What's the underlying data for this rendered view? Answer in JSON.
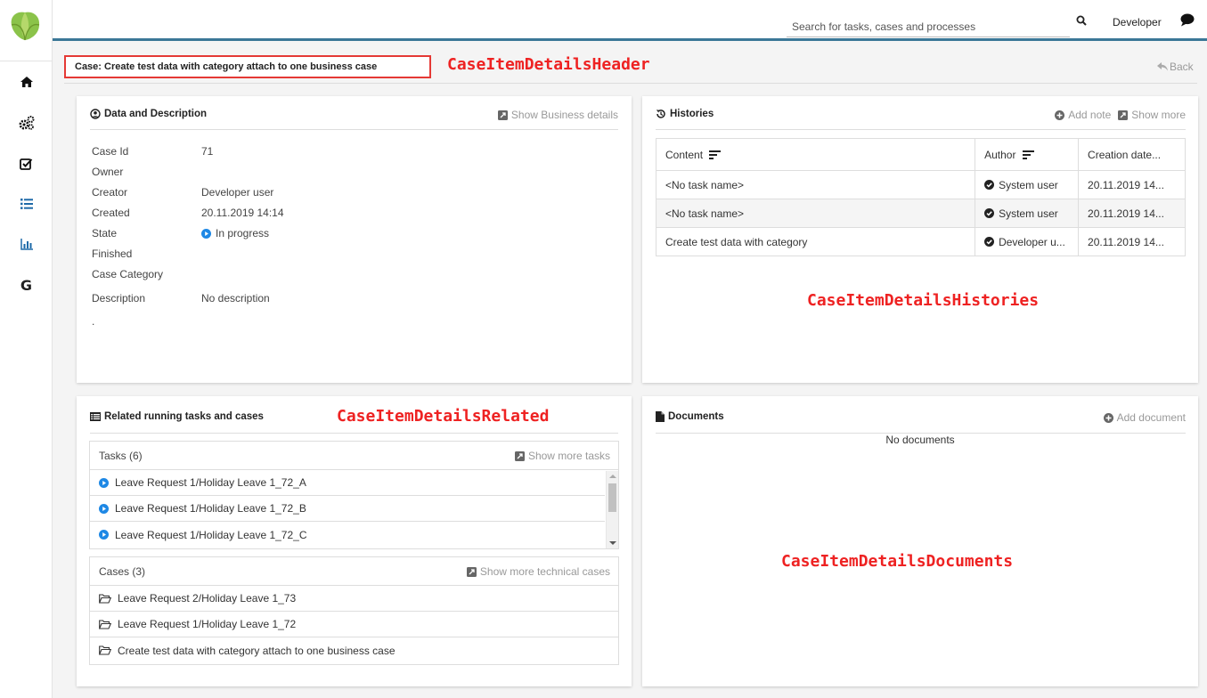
{
  "topbar": {
    "search_placeholder": "Search for tasks, cases and processes",
    "user_name": "Developer"
  },
  "sidebar": {
    "items": [
      {
        "icon": "home-icon"
      },
      {
        "icon": "processes-icon"
      },
      {
        "icon": "tasks-icon"
      },
      {
        "icon": "cases-list-icon"
      },
      {
        "icon": "statistics-icon"
      },
      {
        "icon": "google-icon",
        "label": "G"
      }
    ]
  },
  "header": {
    "case_title": "Case: Create test data with category attach to one business case",
    "back_label": "Back"
  },
  "annotations": {
    "header": "CaseItemDetailsHeader",
    "histories": "CaseItemDetailsHistories",
    "related": "CaseItemDetailsRelated",
    "documents": "CaseItemDetailsDocuments"
  },
  "data_description": {
    "title": "Data and Description",
    "action": "Show Business details",
    "rows": [
      {
        "label": "Case Id",
        "value": "71"
      },
      {
        "label": "Owner",
        "value": ""
      },
      {
        "label": "Creator",
        "value": "Developer user"
      },
      {
        "label": "Created",
        "value": "20.11.2019 14:14"
      },
      {
        "label": "State",
        "value": "In progress"
      },
      {
        "label": "Finished",
        "value": ""
      },
      {
        "label": "Case Category",
        "value": ""
      },
      {
        "label": "Description",
        "value": "No description"
      }
    ],
    "dot": "."
  },
  "histories": {
    "title": "Histories",
    "add_note": "Add note",
    "show_more": "Show more",
    "columns": [
      "Content",
      "Author",
      "Creation date..."
    ],
    "rows": [
      {
        "content": "<No task name>",
        "author": "System user",
        "date": "20.11.2019 14..."
      },
      {
        "content": "<No task name>",
        "author": "System user",
        "date": "20.11.2019 14..."
      },
      {
        "content": "Create test data with category",
        "author": "Developer u...",
        "date": "20.11.2019 14..."
      }
    ]
  },
  "related": {
    "title": "Related running tasks and cases",
    "tasks_label": "Tasks (6)",
    "tasks_action": "Show more tasks",
    "tasks": [
      "Leave Request 1/Holiday Leave 1_72_A",
      "Leave Request 1/Holiday Leave 1_72_B",
      "Leave Request 1/Holiday Leave 1_72_C"
    ],
    "cases_label": "Cases (3)",
    "cases_action": "Show more technical cases",
    "cases": [
      "Leave Request 2/Holiday Leave 1_73",
      "Leave Request 1/Holiday Leave 1_72",
      "Create test data with category attach to one business case"
    ]
  },
  "documents": {
    "title": "Documents",
    "action": "Add document",
    "empty": "No documents"
  },
  "colors": {
    "accent": "#3a7797",
    "annotation": "#ee2222",
    "state_in_progress": "#1e88e5"
  }
}
